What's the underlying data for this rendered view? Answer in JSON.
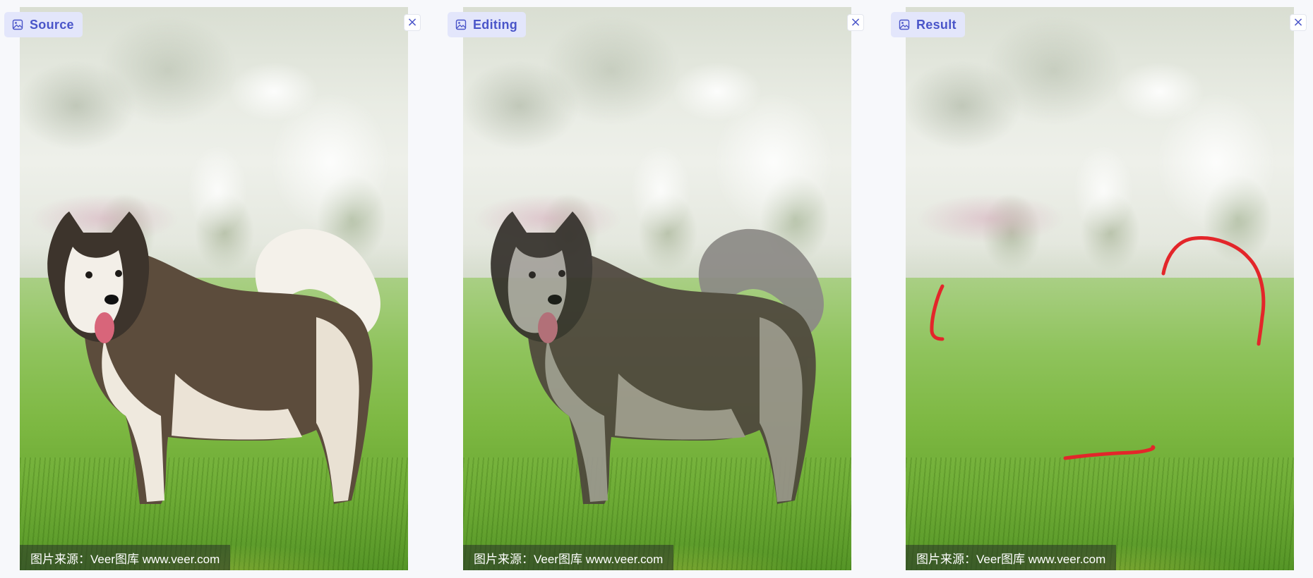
{
  "panels": [
    {
      "title": "Source",
      "credit": "图片来源：Veer图库 www.veer.com",
      "icon": "image-icon",
      "close": "×"
    },
    {
      "title": "Editing",
      "credit": "图片来源：Veer图库 www.veer.com",
      "icon": "image-icon",
      "close": "×"
    },
    {
      "title": "Result",
      "credit": "图片来源：Veer图库 www.veer.com",
      "icon": "image-icon",
      "close": "×"
    }
  ],
  "colors": {
    "accent": "#4a55c9",
    "tag_bg": "#e3e6fb",
    "annotation": "#e3262a"
  }
}
